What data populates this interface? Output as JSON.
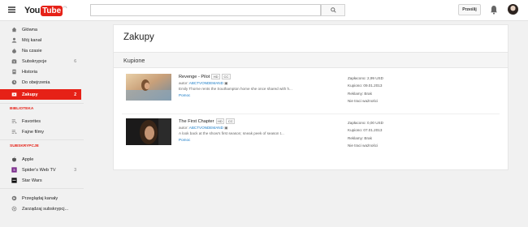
{
  "logo": {
    "you": "You",
    "tube": "Tube",
    "region": "PL"
  },
  "header": {
    "search_placeholder": "",
    "upload_label": "Prześlij"
  },
  "sidebar": {
    "main_items": [
      {
        "label": "Główna",
        "icon": "home-icon",
        "count": ""
      },
      {
        "label": "Mój kanał",
        "icon": "person-icon",
        "count": ""
      },
      {
        "label": "Na czasie",
        "icon": "flame-icon",
        "count": ""
      },
      {
        "label": "Subskrypcje",
        "icon": "subscriptions-icon",
        "count": "6"
      },
      {
        "label": "Historia",
        "icon": "history-icon",
        "count": ""
      },
      {
        "label": "Do obejrzenia",
        "icon": "clock-icon",
        "count": ""
      },
      {
        "label": "Zakupy",
        "icon": "purchases-icon",
        "count": "2",
        "active": true
      }
    ],
    "library_heading": "BIBLIOTEKA",
    "library_items": [
      {
        "label": "Favorites",
        "icon": "playlist-icon"
      },
      {
        "label": "Fajne filmy",
        "icon": "playlist-icon"
      }
    ],
    "subs_heading": "SUBSKRYPCJE",
    "subs_items": [
      {
        "label": "Apple",
        "icon": "apple-icon",
        "count": ""
      },
      {
        "label": "Spider's Web TV",
        "icon": "channel-icon",
        "count": "3"
      },
      {
        "label": "Star Wars",
        "icon": "starwars-icon",
        "count": ""
      }
    ],
    "bottom_items": [
      {
        "label": "Przeglądaj kanały",
        "icon": "browse-icon"
      },
      {
        "label": "Zarządzaj subskrypcj...",
        "icon": "gear-icon"
      }
    ]
  },
  "main": {
    "title": "Zakupy",
    "section_title": "Kupione",
    "items": [
      {
        "title": "Revenge - Pilot",
        "badges": [
          "HD",
          "CC"
        ],
        "author_label": "autor:",
        "author": "ABCTVONDEMAND",
        "description": "Emily Thorne rents the Southampton home she once shared with h...",
        "help": "Pomoc",
        "paid": "Zapłacono: 2,99 USD",
        "bought": "Kupiono: 09.01.2013",
        "ads": "Reklamy: Brak",
        "expiry": "Nie traci ważności"
      },
      {
        "title": "The First Chapter",
        "badges": [
          "HD",
          "CC"
        ],
        "author_label": "autor:",
        "author": "ABCTVONDEMAND",
        "description": "A look back at the show's first season; sneak peek of season t...",
        "help": "Pomoc",
        "paid": "Zapłacono: 0,00 USD",
        "bought": "Kupiono: 07.01.2013",
        "ads": "Reklamy: Brak",
        "expiry": "Nie traci ważności"
      }
    ]
  },
  "colors": {
    "accent": "#e62117",
    "link": "#167ac6"
  }
}
